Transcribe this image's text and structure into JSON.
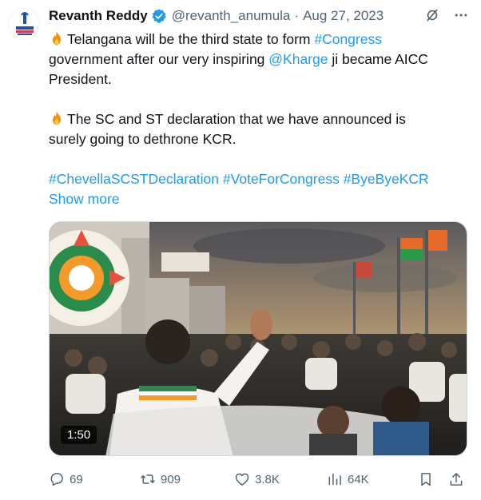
{
  "author": {
    "name": "Revanth Reddy",
    "handle": "@revanth_anumula",
    "separator": "·",
    "date": "Aug 27, 2023",
    "avatar_text": "TELANGANA PRADESH"
  },
  "body": {
    "line1": {
      "emoji": "fire",
      "text": "Telangana will be the third state to form ",
      "hashtag": "#Congress"
    },
    "line2": {
      "text_before": "government after our very inspiring ",
      "mention": "@Kharge",
      "text_after": " ji became AICC"
    },
    "line3": "President.",
    "line4": {
      "emoji": "fire",
      "text": "The SC and ST declaration that we have announced is"
    },
    "line5": "surely going to dethrone KCR.",
    "hashtags": [
      "#ChevellaSCSTDeclaration",
      "#VoteForCongress",
      "#ByeByeKCR"
    ],
    "show_more": "Show more"
  },
  "media": {
    "duration": "1:50"
  },
  "actions": {
    "replies": "69",
    "reposts": "909",
    "likes": "3.8K",
    "views": "64K"
  },
  "icons": {
    "verified": "verified-badge-icon",
    "grok": "grok-icon",
    "more": "more-icon",
    "reply": "reply-icon",
    "repost": "repost-icon",
    "like": "like-icon",
    "views": "views-icon",
    "bookmark": "bookmark-icon",
    "share": "share-icon"
  },
  "colors": {
    "link": "#1d9bf0",
    "secondary": "#536471",
    "text": "#0f1419"
  }
}
